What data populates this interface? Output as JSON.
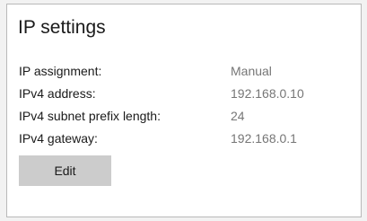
{
  "panel": {
    "title": "IP settings",
    "rows": [
      {
        "label": "IP assignment:",
        "value": "Manual"
      },
      {
        "label": "IPv4 address:",
        "value": "192.168.0.10"
      },
      {
        "label": "IPv4 subnet prefix length:",
        "value": "24"
      },
      {
        "label": "IPv4 gateway:",
        "value": "192.168.0.1"
      }
    ],
    "edit_label": "Edit"
  },
  "colors": {
    "background": "#f2f2f2",
    "panel": "#ffffff",
    "border": "#b9b9b9",
    "button": "#cccccc",
    "label_text": "#1a1a1a",
    "value_text": "#767676"
  }
}
